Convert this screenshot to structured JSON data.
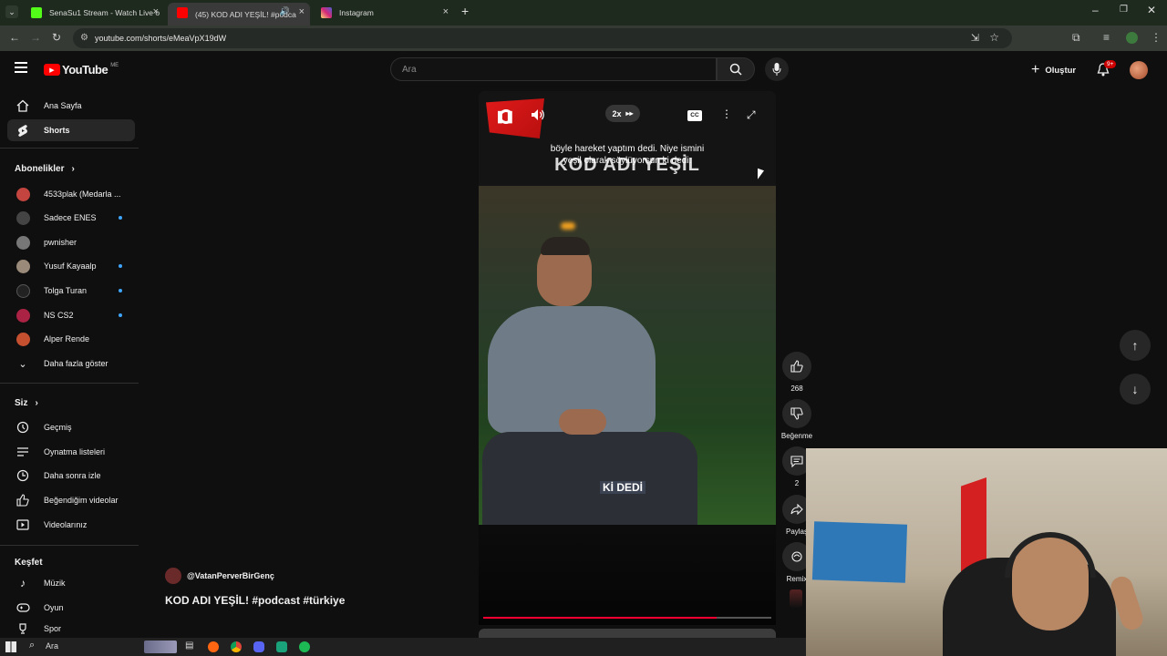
{
  "browser": {
    "tabs": [
      {
        "label": "SenaSu1 Stream - Watch Live o",
        "fav": "#53fc18"
      },
      {
        "label": "(45) KOD ADI YEŞİL! #podca",
        "fav": "#ff0000"
      },
      {
        "label": "Instagram",
        "fav": "#d62976"
      }
    ],
    "url": "youtube.com/shorts/eMeaVpX19dW"
  },
  "youtube": {
    "logo_text": "YouTube",
    "region": "ME",
    "search_placeholder": "Ara",
    "create_label": "Oluştur",
    "notif_badge": "9+"
  },
  "sidebar": {
    "main": [
      {
        "label": "Ana Sayfa",
        "icon": "home-icon"
      },
      {
        "label": "Shorts",
        "icon": "shorts-icon"
      }
    ],
    "subs_title": "Abonelikler",
    "subs": [
      {
        "label": "4533plak (Medarla ...",
        "color": "#c4453f",
        "dot": false
      },
      {
        "label": "Sadece ENES",
        "color": "#444",
        "dot": true
      },
      {
        "label": "pwnisher",
        "color": "#777",
        "dot": false
      },
      {
        "label": "Yusuf Kayaalp",
        "color": "#9a8a7a",
        "dot": true
      },
      {
        "label": "Tolga Turan",
        "color": "#222",
        "dot": true
      },
      {
        "label": "NS CS2",
        "color": "#aa2244",
        "dot": true
      },
      {
        "label": "Alper Rende",
        "color": "#c45030",
        "dot": false
      }
    ],
    "more_label": "Daha fazla göster",
    "you_title": "Siz",
    "you": [
      {
        "label": "Geçmiş",
        "icon": "history-icon"
      },
      {
        "label": "Oynatma listeleri",
        "icon": "playlist-icon"
      },
      {
        "label": "Daha sonra izle",
        "icon": "clock-icon"
      },
      {
        "label": "Beğendiğim videolar",
        "icon": "like-icon"
      },
      {
        "label": "Videolarınız",
        "icon": "video-icon"
      }
    ],
    "explore_title": "Keşfet",
    "explore": [
      {
        "label": "Müzik",
        "icon": "music-icon"
      },
      {
        "label": "Oyun",
        "icon": "gamepad-icon"
      },
      {
        "label": "Spor",
        "icon": "trophy-icon"
      }
    ]
  },
  "player": {
    "speed": "2x",
    "cc": "CC",
    "subtitle_line1": "böyle hareket yaptım dedi. Niye ismini",
    "subtitle_line2": "yeşil olarak söylüyorsun ki dedi.",
    "title_overlay": "KOD ADI YEŞİL",
    "burned_caption": "Kİ DEDİ",
    "progress": 0.81
  },
  "actions": {
    "likes": "268",
    "dislike_label": "Beğenme",
    "comments": "2",
    "share_label": "Paylaş",
    "remix_label": "Remix"
  },
  "meta": {
    "channel": "@VatanPerverBirGenç",
    "title": "KOD ADI YEŞİL! #podcast #türkiye"
  },
  "taskbar": {
    "search": "Ara"
  }
}
